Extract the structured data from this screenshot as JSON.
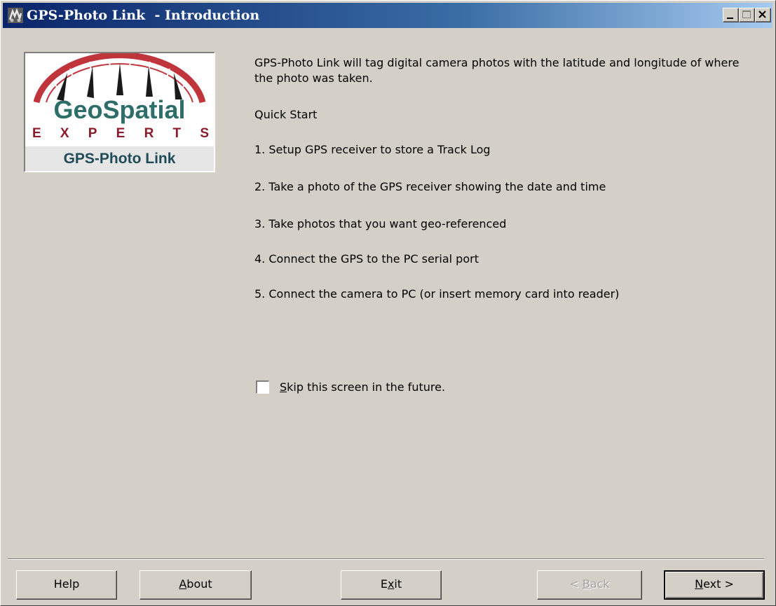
{
  "window": {
    "title": "GPS-Photo Link  - Introduction",
    "app_icon": "app-icon",
    "controls": [
      "minimize-icon",
      "maximize-icon",
      "close-icon"
    ]
  },
  "logo": {
    "line1": "GeoSpatial",
    "line2": [
      "E",
      "X",
      "P",
      "E",
      "R",
      "T",
      "S"
    ],
    "line3": "GPS-Photo Link",
    "colors": {
      "geo": "#2e6e68",
      "experts": "#8b1a2a",
      "arc": "#c0343c"
    }
  },
  "content": {
    "intro": "GPS-Photo Link will tag digital camera photos with the latitude and longitude of where the photo was taken.",
    "quick_start_heading": "Quick Start",
    "steps": [
      "1. Setup GPS receiver to store a Track Log",
      "2. Take a photo of the GPS receiver showing the date and time",
      "3. Take photos that you want geo-referenced",
      "4. Connect the GPS to the PC serial port",
      "5. Connect the camera to PC (or insert memory card into reader)"
    ]
  },
  "skip_checkbox": {
    "label_mnemonic": "S",
    "label_rest": "kip this screen in the future.",
    "checked": false
  },
  "buttons": {
    "help": "Help",
    "about": {
      "mnemonic": "A",
      "rest": "bout"
    },
    "exit": {
      "pre": "E",
      "mnemonic": "x",
      "rest": "it"
    },
    "back": {
      "pre": "< ",
      "mnemonic": "B",
      "rest": "ack",
      "enabled": false
    },
    "next": {
      "mnemonic": "N",
      "rest": "ext >"
    }
  }
}
